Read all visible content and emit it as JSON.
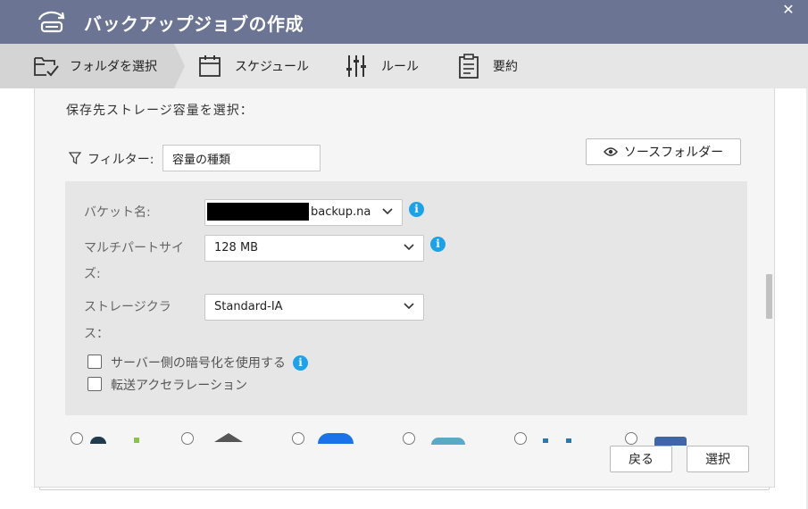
{
  "window": {
    "title": "バックアップジョブの作成",
    "app_icon": "backup-drive-icon",
    "close_label": "✕"
  },
  "steps": [
    {
      "label": "フォルダを選択",
      "icon": "folder-check-icon",
      "active": true
    },
    {
      "label": "スケジュール",
      "icon": "calendar-icon",
      "active": false
    },
    {
      "label": "ルール",
      "icon": "sliders-icon",
      "active": false
    },
    {
      "label": "要約",
      "icon": "clipboard-icon",
      "active": false
    }
  ],
  "section": {
    "title": "保存先ストレージ容量を選択："
  },
  "filter": {
    "label": "フィルター:",
    "value": "容量の種類"
  },
  "source_button": {
    "label": "ソースフォルダー"
  },
  "settings": {
    "bucket": {
      "label": "バケット名:",
      "value_suffix": "backup.na"
    },
    "multipart": {
      "label_line1": "マルチパートサイ",
      "label_line2": "ズ:",
      "value": "128 MB"
    },
    "storage_class": {
      "label_line1": "ストレージクラ",
      "label_line2": "ス：",
      "value": "Standard-IA"
    },
    "encryption": {
      "label": "サーバー側の暗号化を使用する",
      "checked": false
    },
    "acceleration": {
      "label": "転送アクセラレーション",
      "checked": false
    }
  },
  "buttons": {
    "back": "戻る",
    "select": "選択"
  },
  "colors": {
    "titlebar": "#6b7493",
    "info": "#1aa3e8",
    "panel": "#f5f5f5",
    "settings_box": "#e6e6e6"
  }
}
